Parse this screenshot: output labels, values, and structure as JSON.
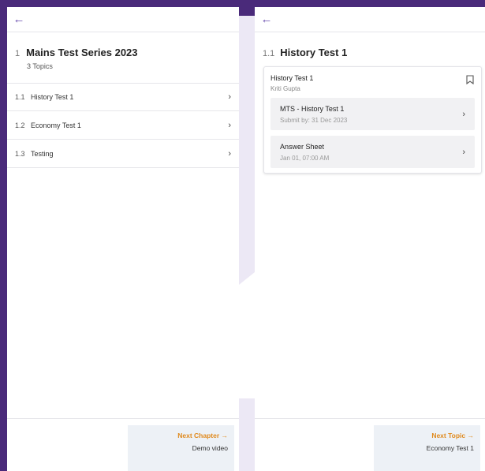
{
  "left": {
    "chapter": {
      "number": "1",
      "title": "Mains Test Series 2023",
      "subtitle": "3 Topics"
    },
    "topics": [
      {
        "number": "1.1",
        "label": "History Test 1"
      },
      {
        "number": "1.2",
        "label": "Economy Test 1"
      },
      {
        "number": "1.3",
        "label": "Testing"
      }
    ],
    "next": {
      "link": "Next Chapter →",
      "name": "Demo video"
    }
  },
  "right": {
    "topic": {
      "number": "1.1",
      "title": "History Test 1"
    },
    "card": {
      "title": "History Test 1",
      "author": "Kriti Gupta",
      "items": [
        {
          "title": "MTS - History Test 1",
          "sub": "Submit by: 31 Dec 2023"
        },
        {
          "title": "Answer Sheet",
          "sub": "Jan 01, 07:00 AM"
        }
      ]
    },
    "next": {
      "link": "Next Topic →",
      "name": "Economy Test 1"
    }
  },
  "icons": {
    "back": "arrow-left-icon",
    "chevron": "chevron-right-icon",
    "bookmark": "bookmark-icon"
  },
  "colors": {
    "accent": "#6b4fb0",
    "next_link": "#e08a1e",
    "frame": "#4a2a7a"
  }
}
